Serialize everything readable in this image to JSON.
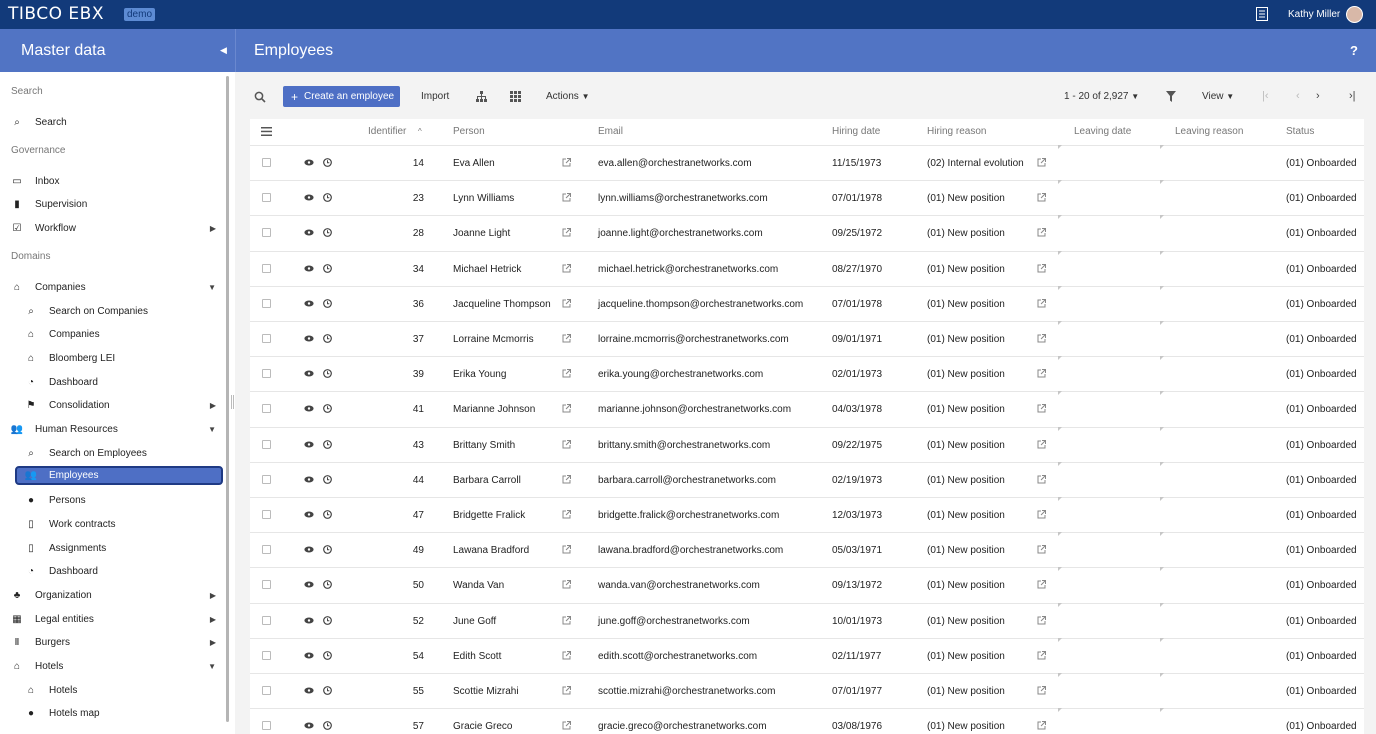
{
  "app": {
    "brand": "TIBCO EBX",
    "badge": "demo",
    "user": "Kathy Miller"
  },
  "header": {
    "section_title": "Master data",
    "page_title": "Employees",
    "help": "?"
  },
  "sidebar": {
    "sections": [
      {
        "label": "Search",
        "items": [
          {
            "label": "Search",
            "icon": "search-icon"
          }
        ]
      },
      {
        "label": "Governance",
        "items": [
          {
            "label": "Inbox",
            "icon": "inbox-icon"
          },
          {
            "label": "Supervision",
            "icon": "bar-chart-icon"
          },
          {
            "label": "Workflow",
            "icon": "check-square-icon",
            "expandable": true
          }
        ]
      },
      {
        "label": "Domains",
        "items": [
          {
            "label": "Companies",
            "icon": "bank-icon",
            "expanded": true,
            "children": [
              {
                "label": "Search on Companies",
                "icon": "search-icon"
              },
              {
                "label": "Companies",
                "icon": "bank-icon"
              },
              {
                "label": "Bloomberg LEI",
                "icon": "bank-icon"
              },
              {
                "label": "Dashboard",
                "icon": "pie-chart-icon"
              },
              {
                "label": "Consolidation",
                "icon": "flag-icon",
                "expandable": true
              }
            ]
          },
          {
            "label": "Human Resources",
            "icon": "users-icon",
            "expanded": true,
            "children": [
              {
                "label": "Search on Employees",
                "icon": "search-icon"
              },
              {
                "label": "Employees",
                "icon": "users-icon",
                "active": true
              },
              {
                "label": "Persons",
                "icon": "user-icon"
              },
              {
                "label": "Work contracts",
                "icon": "document-icon"
              },
              {
                "label": "Assignments",
                "icon": "document-icon"
              },
              {
                "label": "Dashboard",
                "icon": "pie-chart-icon"
              }
            ]
          },
          {
            "label": "Organization",
            "icon": "hierarchy-icon",
            "expandable": true
          },
          {
            "label": "Legal entities",
            "icon": "building-icon",
            "expandable": true
          },
          {
            "label": "Burgers",
            "icon": "cutlery-icon",
            "expandable": true
          },
          {
            "label": "Hotels",
            "icon": "home-icon",
            "expanded": true,
            "children": [
              {
                "label": "Hotels",
                "icon": "home-icon"
              },
              {
                "label": "Hotels map",
                "icon": "globe-icon"
              }
            ]
          }
        ]
      }
    ]
  },
  "toolbar": {
    "create_label": "Create an employee",
    "import_label": "Import",
    "actions_label": "Actions",
    "pagination": "1 - 20 of 2,927",
    "view_label": "View"
  },
  "table": {
    "columns": [
      "Identifier",
      "Person",
      "Email",
      "Hiring date",
      "Hiring reason",
      "Leaving date",
      "Leaving reason",
      "Status"
    ],
    "rows": [
      {
        "id": "14",
        "person": "Eva Allen",
        "email": "eva.allen@orchestranetworks.com",
        "hiring_date": "11/15/1973",
        "reason": "(02) Internal evolution",
        "status": "(01) Onboarded"
      },
      {
        "id": "23",
        "person": "Lynn Williams",
        "email": "lynn.williams@orchestranetworks.com",
        "hiring_date": "07/01/1978",
        "reason": "(01) New position",
        "status": "(01) Onboarded"
      },
      {
        "id": "28",
        "person": "Joanne Light",
        "email": "joanne.light@orchestranetworks.com",
        "hiring_date": "09/25/1972",
        "reason": "(01) New position",
        "status": "(01) Onboarded"
      },
      {
        "id": "34",
        "person": "Michael Hetrick",
        "email": "michael.hetrick@orchestranetworks.com",
        "hiring_date": "08/27/1970",
        "reason": "(01) New position",
        "status": "(01) Onboarded"
      },
      {
        "id": "36",
        "person": "Jacqueline Thompson",
        "email": "jacqueline.thompson@orchestranetworks.com",
        "hiring_date": "07/01/1978",
        "reason": "(01) New position",
        "status": "(01) Onboarded"
      },
      {
        "id": "37",
        "person": "Lorraine Mcmorris",
        "email": "lorraine.mcmorris@orchestranetworks.com",
        "hiring_date": "09/01/1971",
        "reason": "(01) New position",
        "status": "(01) Onboarded"
      },
      {
        "id": "39",
        "person": "Erika Young",
        "email": "erika.young@orchestranetworks.com",
        "hiring_date": "02/01/1973",
        "reason": "(01) New position",
        "status": "(01) Onboarded"
      },
      {
        "id": "41",
        "person": "Marianne Johnson",
        "email": "marianne.johnson@orchestranetworks.com",
        "hiring_date": "04/03/1978",
        "reason": "(01) New position",
        "status": "(01) Onboarded"
      },
      {
        "id": "43",
        "person": "Brittany Smith",
        "email": "brittany.smith@orchestranetworks.com",
        "hiring_date": "09/22/1975",
        "reason": "(01) New position",
        "status": "(01) Onboarded"
      },
      {
        "id": "44",
        "person": "Barbara Carroll",
        "email": "barbara.carroll@orchestranetworks.com",
        "hiring_date": "02/19/1973",
        "reason": "(01) New position",
        "status": "(01) Onboarded"
      },
      {
        "id": "47",
        "person": "Bridgette Fralick",
        "email": "bridgette.fralick@orchestranetworks.com",
        "hiring_date": "12/03/1973",
        "reason": "(01) New position",
        "status": "(01) Onboarded"
      },
      {
        "id": "49",
        "person": "Lawana Bradford",
        "email": "lawana.bradford@orchestranetworks.com",
        "hiring_date": "05/03/1971",
        "reason": "(01) New position",
        "status": "(01) Onboarded"
      },
      {
        "id": "50",
        "person": "Wanda Van",
        "email": "wanda.van@orchestranetworks.com",
        "hiring_date": "09/13/1972",
        "reason": "(01) New position",
        "status": "(01) Onboarded"
      },
      {
        "id": "52",
        "person": "June Goff",
        "email": "june.goff@orchestranetworks.com",
        "hiring_date": "10/01/1973",
        "reason": "(01) New position",
        "status": "(01) Onboarded"
      },
      {
        "id": "54",
        "person": "Edith Scott",
        "email": "edith.scott@orchestranetworks.com",
        "hiring_date": "02/11/1977",
        "reason": "(01) New position",
        "status": "(01) Onboarded"
      },
      {
        "id": "55",
        "person": "Scottie Mizrahi",
        "email": "scottie.mizrahi@orchestranetworks.com",
        "hiring_date": "07/01/1977",
        "reason": "(01) New position",
        "status": "(01) Onboarded"
      },
      {
        "id": "57",
        "person": "Gracie Greco",
        "email": "gracie.greco@orchestranetworks.com",
        "hiring_date": "03/08/1976",
        "reason": "(01) New position",
        "status": "(01) Onboarded"
      }
    ]
  },
  "colors": {
    "topbar": "#123a7a",
    "header": "#5174c4",
    "accent": "#4e6fc5"
  }
}
